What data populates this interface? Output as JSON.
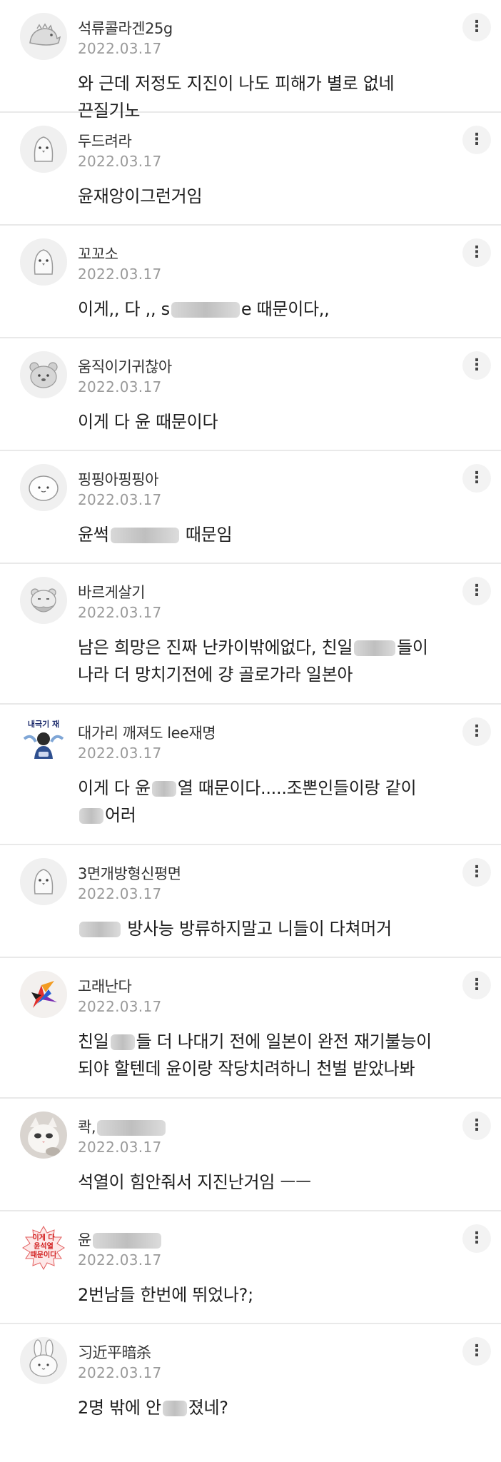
{
  "comments": [
    {
      "nickname": "석류콜라겐25g",
      "date": "2022.03.17",
      "text": "와 근데 저정도 지진이 나도 피해가 별로 없네\n끈질기노",
      "avatar_icon": "dinosaur-icon",
      "more_icon": "more-vertical-icon"
    },
    {
      "nickname": "두드려라",
      "date": "2022.03.17",
      "text": "윤재앙이그런거임",
      "avatar_icon": "penguin-icon",
      "more_icon": "more-vertical-icon"
    },
    {
      "nickname": "꼬꼬소",
      "date": "2022.03.17",
      "text_before": "이게,, 다 ,, s",
      "text_after": "e 때문이다,,",
      "avatar_icon": "penguin-icon",
      "more_icon": "more-vertical-icon"
    },
    {
      "nickname": "움직이기귀찮아",
      "date": "2022.03.17",
      "text": "이게 다 윤 때문이다",
      "avatar_icon": "bear-icon",
      "more_icon": "more-vertical-icon"
    },
    {
      "nickname": "핑핑아핑핑아",
      "date": "2022.03.17",
      "text_before": "윤썩",
      "text_after": " 때문임",
      "avatar_icon": "round-face-icon",
      "more_icon": "more-vertical-icon"
    },
    {
      "nickname": "바르게살기",
      "date": "2022.03.17",
      "text_before": "남은 희망은 진짜 난카이밖에없다, 친일",
      "text_after": "들이\n나라 더 망치기전에 걍 골로가라 일본아",
      "avatar_icon": "bearded-face-icon",
      "more_icon": "more-vertical-icon"
    },
    {
      "nickname": "대가리 깨져도 lee재명",
      "date": "2022.03.17",
      "text_before": "이게 다 윤",
      "text_after": "열 때문이다.....조뽄인들이랑 같이\n",
      "text_tail": "어러",
      "avatar_icon": "character-sticker-icon",
      "more_icon": "more-vertical-icon"
    },
    {
      "nickname": "3면개방형신평면",
      "date": "2022.03.17",
      "text_after": " 방사능 방류하지말고 니들이 다쳐머거",
      "avatar_icon": "penguin-icon",
      "more_icon": "more-vertical-icon"
    },
    {
      "nickname": "고래난다",
      "date": "2022.03.17",
      "text_before": "친일",
      "text_after": "들 더 나대기 전에 일본이 완전 재기불능이\n되야 할텐데 윤이랑 작당치려하니 천벌 받았나봐",
      "avatar_icon": "colorful-bird-icon",
      "more_icon": "more-vertical-icon"
    },
    {
      "nickname": "콱,",
      "date": "2022.03.17",
      "text": "석열이 힘안줘서 지진난거임 ㅡㅡ",
      "avatar_icon": "cat-photo-icon",
      "more_icon": "more-vertical-icon"
    },
    {
      "nickname": "윤",
      "date": "2022.03.17",
      "text": "2번남들 한번에 뛰었나?;",
      "avatar_icon": "text-sticker-icon",
      "sticker_text": "이게 다\n윤석열\n때문이다",
      "more_icon": "more-vertical-icon"
    },
    {
      "nickname": "习近平暗杀",
      "date": "2022.03.17",
      "text_before": "2명 밖에 안",
      "text_after": "졌네?",
      "avatar_icon": "rabbit-icon",
      "more_icon": "more-vertical-icon"
    }
  ],
  "colors": {
    "divider": "#e9e9e9",
    "date": "#9a9a9a",
    "text": "#1e1e1e"
  },
  "more_symbol": "⋮",
  "sticker_header": "내극기 재"
}
